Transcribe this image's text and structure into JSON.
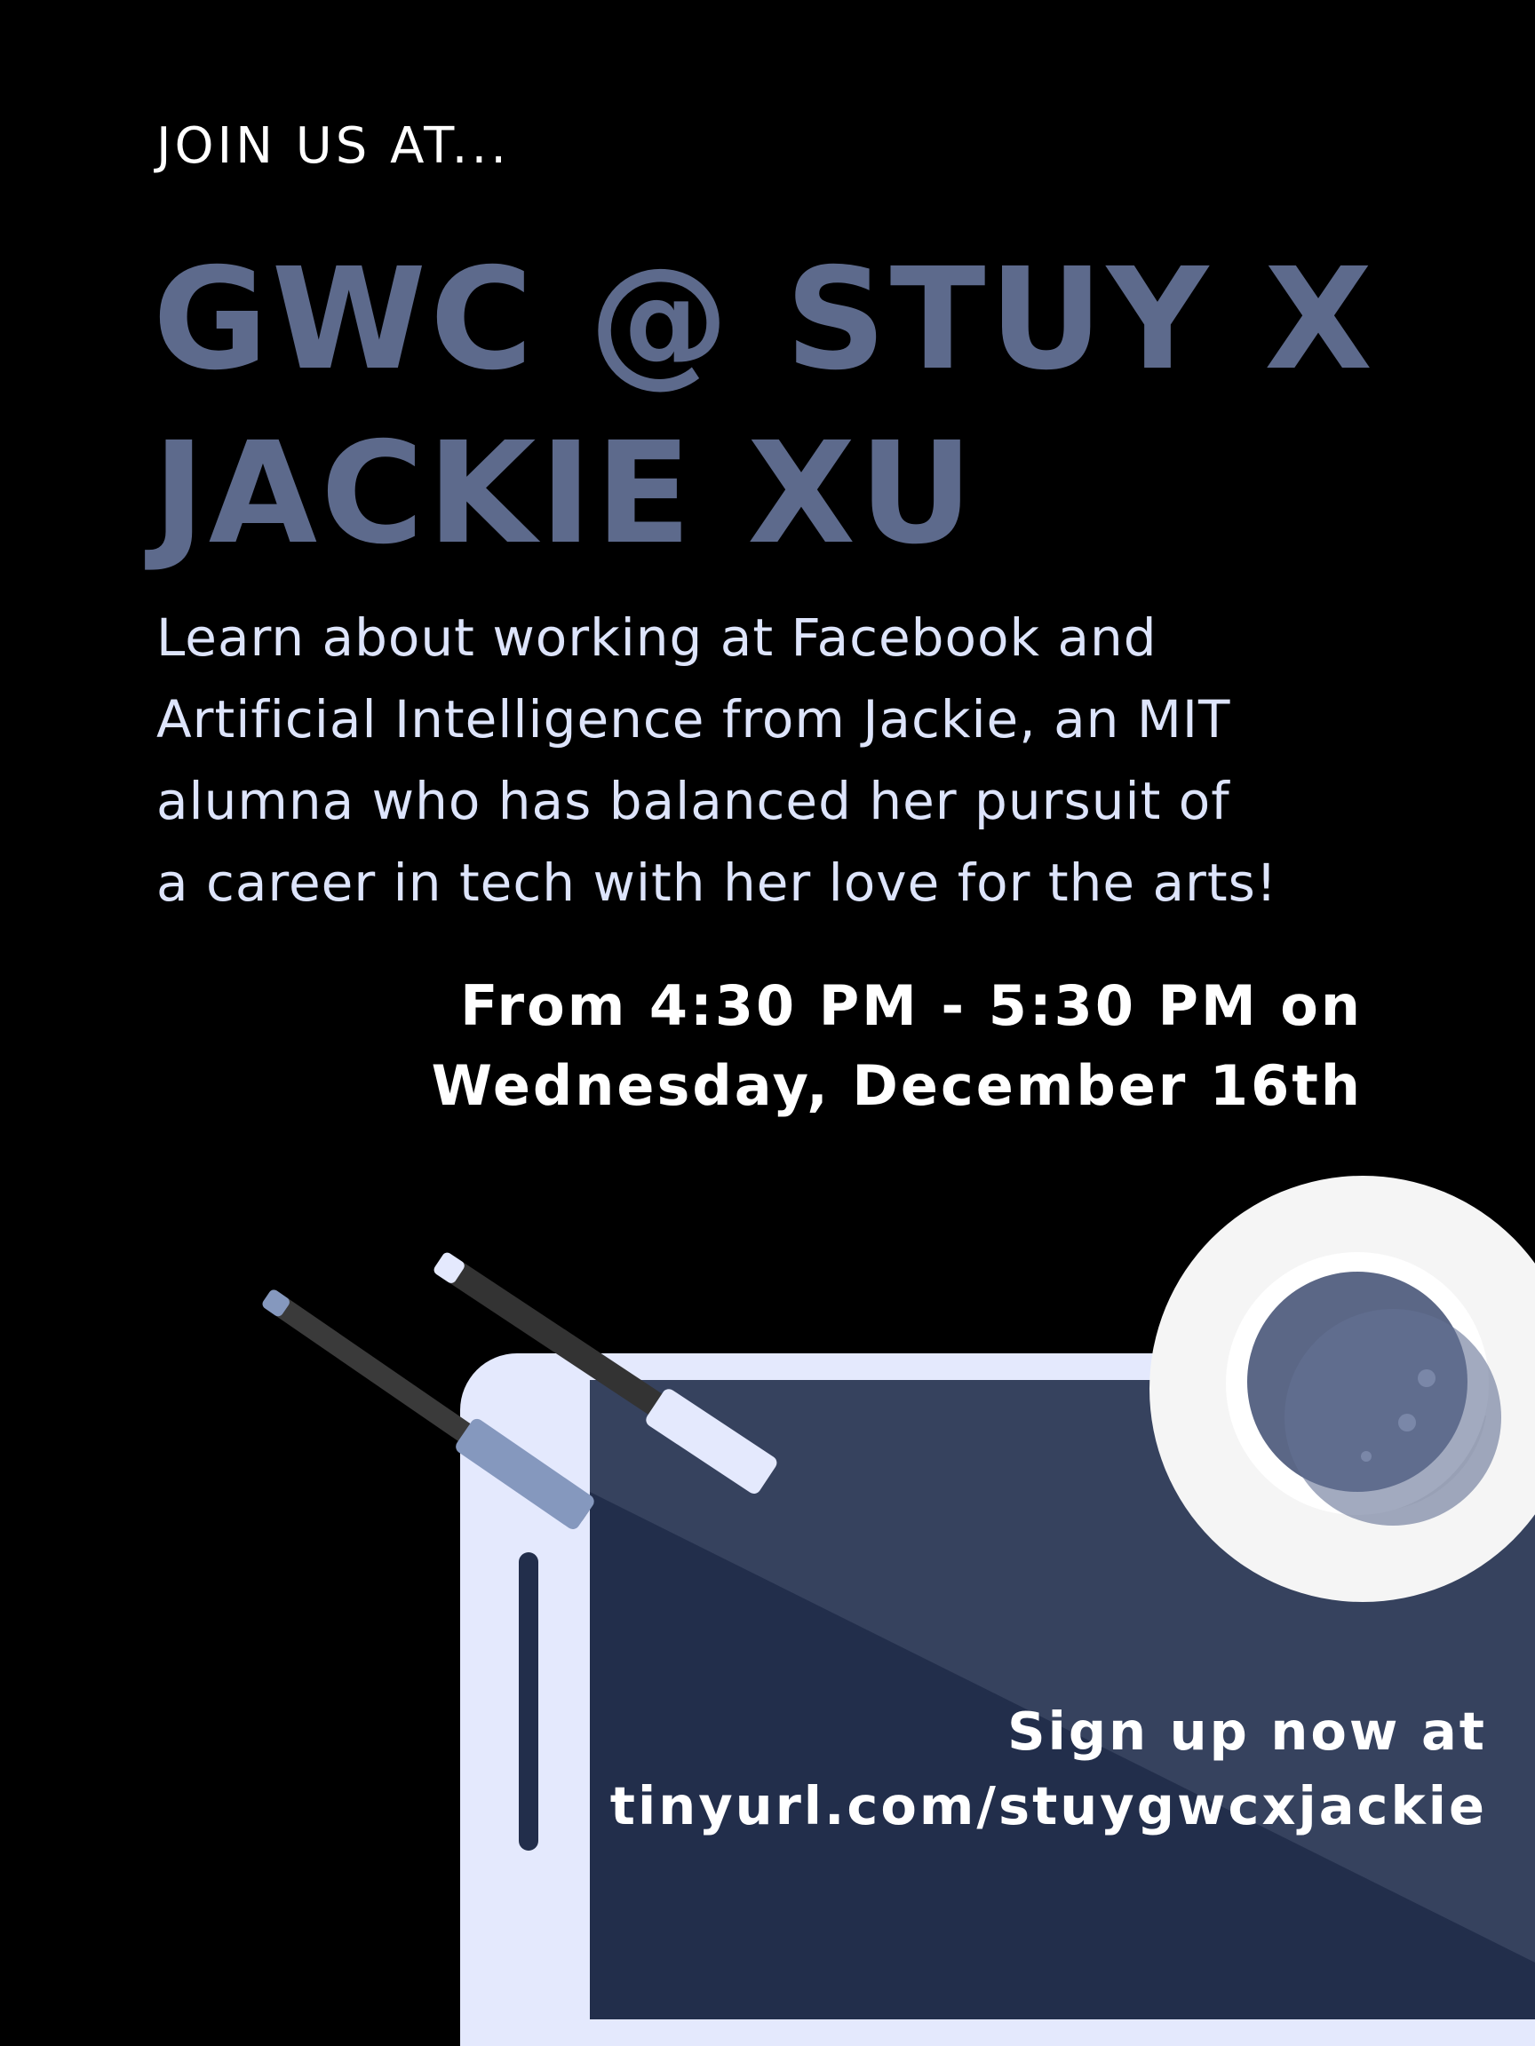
{
  "poster": {
    "kicker": "JOIN US AT...",
    "title_line1": "GWC @ STUY X",
    "title_line2": "JACKIE XU",
    "description_lines": [
      "Learn about working at Facebook and",
      "Artificial Intelligence from Jackie, an MIT",
      "alumna who has balanced her pursuit of",
      "a career in tech with her love for the arts!"
    ],
    "time_line1": "From 4:30 PM - 5:30 PM on",
    "time_line2": "Wednesday, December 16th",
    "signup_line1": "Sign up now at",
    "signup_line2": "tinyurl.com/stuygwcxjackie"
  },
  "colors": {
    "background": "#000000",
    "title": "#5d6a8c",
    "description": "#dde4fb",
    "tablet_frame": "#e4e9fd",
    "tablet_screen": "#222e4b",
    "tablet_screen_light": "#36425e",
    "cup": "#f5f5f5",
    "coffee": "#5b6786"
  },
  "icons": {
    "illustration": "tablet-pens-coffee-illustration"
  }
}
